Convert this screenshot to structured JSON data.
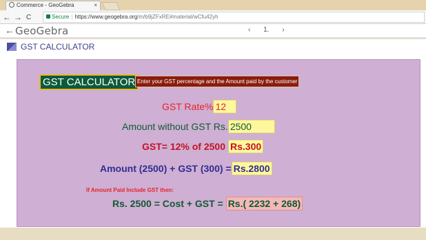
{
  "browser": {
    "tab_title": "Commerce - GeoGebra",
    "tab_close": "×",
    "back": "←",
    "forward": "→",
    "reload": "C",
    "secure_label": "Secure",
    "url_host": "https://www.geogebra.org",
    "url_path": "/m/b9jZFxRE#material/wCfu42yh"
  },
  "geogebra": {
    "back": "←",
    "logo": "GeoGebra",
    "prev": "‹",
    "page": "1.",
    "next": "›"
  },
  "page": {
    "header_title": "GST CALCULATOR"
  },
  "calculator": {
    "badge": "GST CALCULATOR",
    "instruction": "Enter your GST percentage and the Amount paid by the customer",
    "gst_rate_label": "GST Rate%",
    "gst_rate_value": "12",
    "amount_label": "Amount without GST Rs.",
    "amount_value": "2500",
    "gst_formula_label": "GST= 12% of 2500",
    "gst_formula_value": "Rs.300",
    "total_label": "Amount (2500) + GST (300) =",
    "total_value": "Rs.2800",
    "include_note": "If Amount Paid Include GST then:",
    "breakup_label": "Rs. 2500  = Cost + GST =",
    "breakup_value": "Rs.( 2232 + 268)"
  },
  "colors": {
    "panel": "#cfafd3",
    "badge_bg": "#0e5a3b",
    "note_bg": "#8a1c0e",
    "input_bg": "#fff79d",
    "result_bg": "#f5b8b8"
  }
}
